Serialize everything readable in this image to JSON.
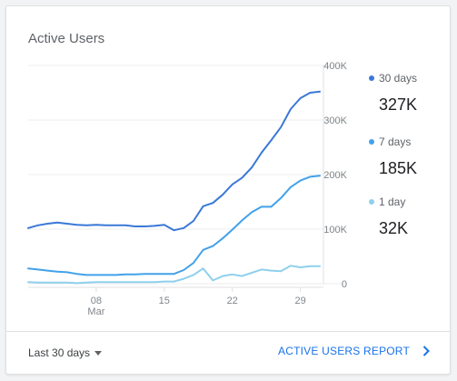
{
  "card": {
    "title": "Active Users"
  },
  "footer": {
    "range_label": "Last 30 days",
    "report_link": "ACTIVE USERS REPORT"
  },
  "legend": [
    {
      "name": "30 days",
      "value": "327K",
      "color": "#3a78d8"
    },
    {
      "name": "7 days",
      "value": "185K",
      "color": "#42a1ea"
    },
    {
      "name": "1 day",
      "value": "32K",
      "color": "#8fd0ec"
    }
  ],
  "chart_data": {
    "type": "line",
    "title": "",
    "xlabel": "",
    "ylabel": "",
    "x": [
      1,
      2,
      3,
      4,
      5,
      6,
      7,
      8,
      9,
      10,
      11,
      12,
      13,
      14,
      15,
      16,
      17,
      18,
      19,
      20,
      21,
      22,
      23,
      24,
      25,
      26,
      27,
      28,
      29,
      30,
      31
    ],
    "x_ticks": [
      {
        "value": 8,
        "label": "08",
        "sublabel": "Mar"
      },
      {
        "value": 15,
        "label": "15",
        "sublabel": ""
      },
      {
        "value": 22,
        "label": "22",
        "sublabel": ""
      },
      {
        "value": 29,
        "label": "29",
        "sublabel": ""
      }
    ],
    "ylim": [
      0,
      400000
    ],
    "y_ticks": [
      {
        "value": 0,
        "label": "0"
      },
      {
        "value": 100000,
        "label": "100K"
      },
      {
        "value": 200000,
        "label": "200K"
      },
      {
        "value": 300000,
        "label": "300K"
      },
      {
        "value": 400000,
        "label": "400K"
      }
    ],
    "axis_side": "right",
    "grid": true,
    "legend_position": "right",
    "series": [
      {
        "name": "30 days",
        "color": "#3a78d8",
        "values": [
          102000,
          107000,
          110000,
          112000,
          110000,
          108000,
          107000,
          108000,
          107000,
          107000,
          107000,
          105000,
          105000,
          106000,
          108000,
          98000,
          102000,
          115000,
          142000,
          148000,
          163000,
          182000,
          194000,
          213000,
          240000,
          263000,
          287000,
          320000,
          340000,
          350000,
          352000
        ]
      },
      {
        "name": "7 days",
        "color": "#42a1ea",
        "values": [
          28000,
          26000,
          24000,
          22000,
          21000,
          18000,
          16000,
          16000,
          16000,
          16000,
          17000,
          17000,
          18000,
          18000,
          18000,
          18000,
          25000,
          38000,
          62000,
          69000,
          83000,
          99000,
          116000,
          131000,
          141000,
          141000,
          157000,
          177000,
          189000,
          196000,
          198000
        ]
      },
      {
        "name": "1 day",
        "color": "#8fd0ec",
        "values": [
          3000,
          2000,
          2000,
          2000,
          2000,
          1000,
          2000,
          3000,
          3000,
          3000,
          3000,
          3000,
          3000,
          3000,
          4000,
          4000,
          9000,
          16000,
          28000,
          6000,
          14000,
          17000,
          14000,
          20000,
          26000,
          24000,
          23000,
          33000,
          30000,
          32000,
          32000
        ]
      }
    ]
  }
}
